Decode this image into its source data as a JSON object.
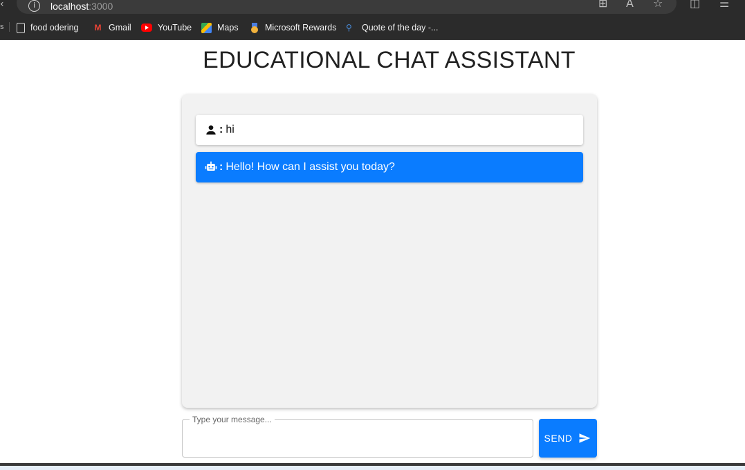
{
  "browser": {
    "url_host": "localhost",
    "url_port": ":3000",
    "bookmarks": [
      {
        "label": "food odering",
        "icon": "document-icon"
      },
      {
        "label": "Gmail",
        "icon": "gmail-icon"
      },
      {
        "label": "YouTube",
        "icon": "youtube-icon"
      },
      {
        "label": "Maps",
        "icon": "maps-icon"
      },
      {
        "label": "Microsoft Rewards",
        "icon": "rewards-medal-icon"
      },
      {
        "label": "Quote of the day -...",
        "icon": "search-icon"
      }
    ]
  },
  "page": {
    "title": "EDUCATIONAL CHAT ASSISTANT"
  },
  "chat": {
    "messages": [
      {
        "sender": "user",
        "icon": "user-icon",
        "text": "hi"
      },
      {
        "sender": "bot",
        "icon": "robot-icon",
        "text": "Hello! How can I assist you today?"
      }
    ]
  },
  "composer": {
    "label": "Type your message...",
    "value": "",
    "send_label": "SEND"
  },
  "colors": {
    "accent": "#0a7cff",
    "panel_bg": "#f2f2f2",
    "chrome_bg": "#2b2b2b"
  }
}
